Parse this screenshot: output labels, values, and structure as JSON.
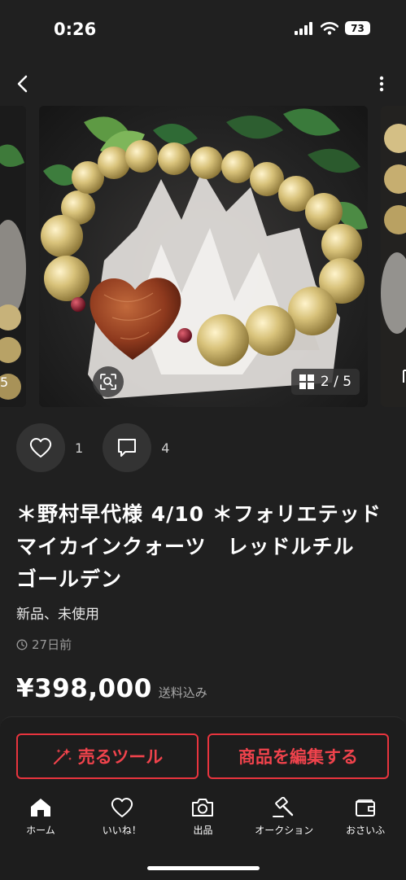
{
  "status": {
    "time": "0:26",
    "battery": "73"
  },
  "gallery": {
    "counter": "2 / 5",
    "side_left_number": "5"
  },
  "actions": {
    "likes": "1",
    "comments": "4"
  },
  "item": {
    "title": "＊野村早代様 4/10 ＊フォリエテッドマイカインクォーツ　レッドルチル　ゴールデン",
    "condition": "新品、未使用",
    "posted": "27日前",
    "price": "¥398,000",
    "shipping": "送料込み"
  },
  "buttons": {
    "sell_tools": "売るツール",
    "edit_item": "商品を編集する"
  },
  "tabs": [
    {
      "label": "ホーム",
      "icon": "home-icon"
    },
    {
      "label": "いいね！",
      "icon": "heart-icon"
    },
    {
      "label": "出品",
      "icon": "camera-icon"
    },
    {
      "label": "オークション",
      "icon": "gavel-icon"
    },
    {
      "label": "おさいふ",
      "icon": "wallet-icon"
    }
  ],
  "colors": {
    "accent": "#e8343e",
    "background": "#202020"
  }
}
